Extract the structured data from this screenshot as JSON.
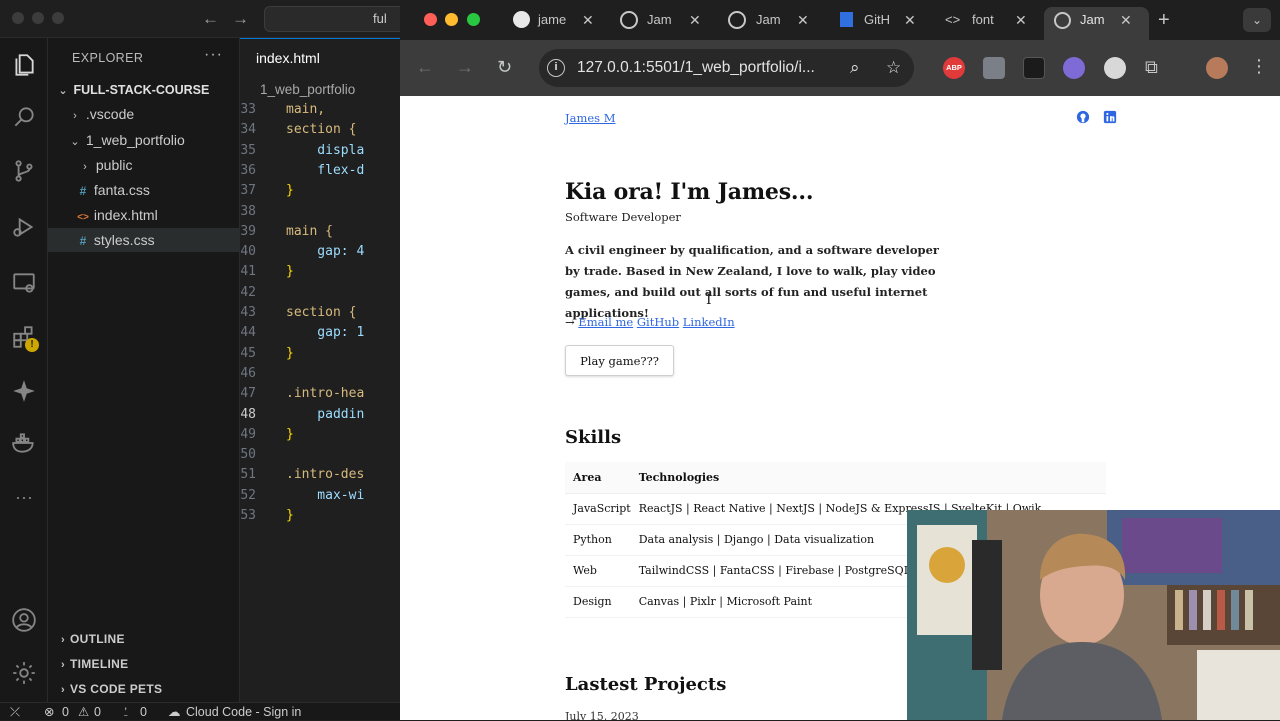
{
  "vscode": {
    "search_text": "ful",
    "sidebar_title": "EXPLORER",
    "tree": [
      {
        "label": "FULL-STACK-COURSE",
        "chev": "⌄"
      },
      {
        "label": ".vscode",
        "chev": "›"
      },
      {
        "label": "1_web_portfolio",
        "chev": "⌄"
      },
      {
        "label": "public",
        "chev": "›"
      },
      {
        "label": "fanta.css",
        "icon": "#"
      },
      {
        "label": "index.html",
        "icon": "<>"
      },
      {
        "label": "styles.css",
        "icon": "#"
      }
    ],
    "sections": [
      "OUTLINE",
      "TIMELINE",
      "VS CODE PETS"
    ],
    "tab_label": "index.html",
    "breadcrumb": "1_web_portfolio",
    "code": [
      {
        "n": "33",
        "text": "main,"
      },
      {
        "n": "34",
        "text": "section {"
      },
      {
        "n": "35",
        "text": "    displa"
      },
      {
        "n": "36",
        "text": "    flex-d"
      },
      {
        "n": "37",
        "text": "}"
      },
      {
        "n": "38",
        "text": ""
      },
      {
        "n": "39",
        "text": "main {"
      },
      {
        "n": "40",
        "text": "    gap: 4"
      },
      {
        "n": "41",
        "text": "}"
      },
      {
        "n": "42",
        "text": ""
      },
      {
        "n": "43",
        "text": "section {"
      },
      {
        "n": "44",
        "text": "    gap: 1"
      },
      {
        "n": "45",
        "text": "}"
      },
      {
        "n": "46",
        "text": ""
      },
      {
        "n": "47",
        "text": ".intro-hea"
      },
      {
        "n": "48",
        "text": "    paddin"
      },
      {
        "n": "49",
        "text": "}"
      },
      {
        "n": "50",
        "text": ""
      },
      {
        "n": "51",
        "text": ".intro-des"
      },
      {
        "n": "52",
        "text": "    max-wi"
      },
      {
        "n": "53",
        "text": "}"
      }
    ],
    "status": {
      "errors": "0",
      "warnings": "0",
      "ports": "0",
      "cloud": "Cloud Code - Sign in"
    }
  },
  "browser": {
    "tabs": [
      "jame",
      "Jam",
      "Jam",
      "GitH",
      "font",
      "Jam"
    ],
    "url": "127.0.0.1:5501/1_web_portfolio/i...",
    "ext_abp": "ABP"
  },
  "site": {
    "nav_name": "James M",
    "hero_title": "Kia ora! I'm James...",
    "hero_subtitle": "Software Developer",
    "hero_description": "A civil engineer by qualification, and a software developer by trade. Based in New Zealand, I love to walk, play video games, and build out all sorts of fun and useful internet applications!",
    "arrow": "→",
    "link_email": "Email me",
    "link_github": "GitHub",
    "link_linkedin": "LinkedIn",
    "play_button": "Play game???",
    "skills_title": "Skills",
    "skills_headers": [
      "Area",
      "Technologies"
    ],
    "skills_rows": [
      {
        "area": "JavaScript",
        "tech": "ReactJS | React Native | NextJS | NodeJS & ExpressJS | SvelteKit | Qwik"
      },
      {
        "area": "Python",
        "tech": "Data analysis | Django | Data visualization"
      },
      {
        "area": "Web",
        "tech": "TailwindCSS | FantaCSS | Firebase | PostgreSQL | CI/"
      },
      {
        "area": "Design",
        "tech": "Canvas | Pixlr | Microsoft Paint"
      }
    ],
    "projects_title": "Lastest Projects",
    "project_date": "July 15, 2023"
  }
}
